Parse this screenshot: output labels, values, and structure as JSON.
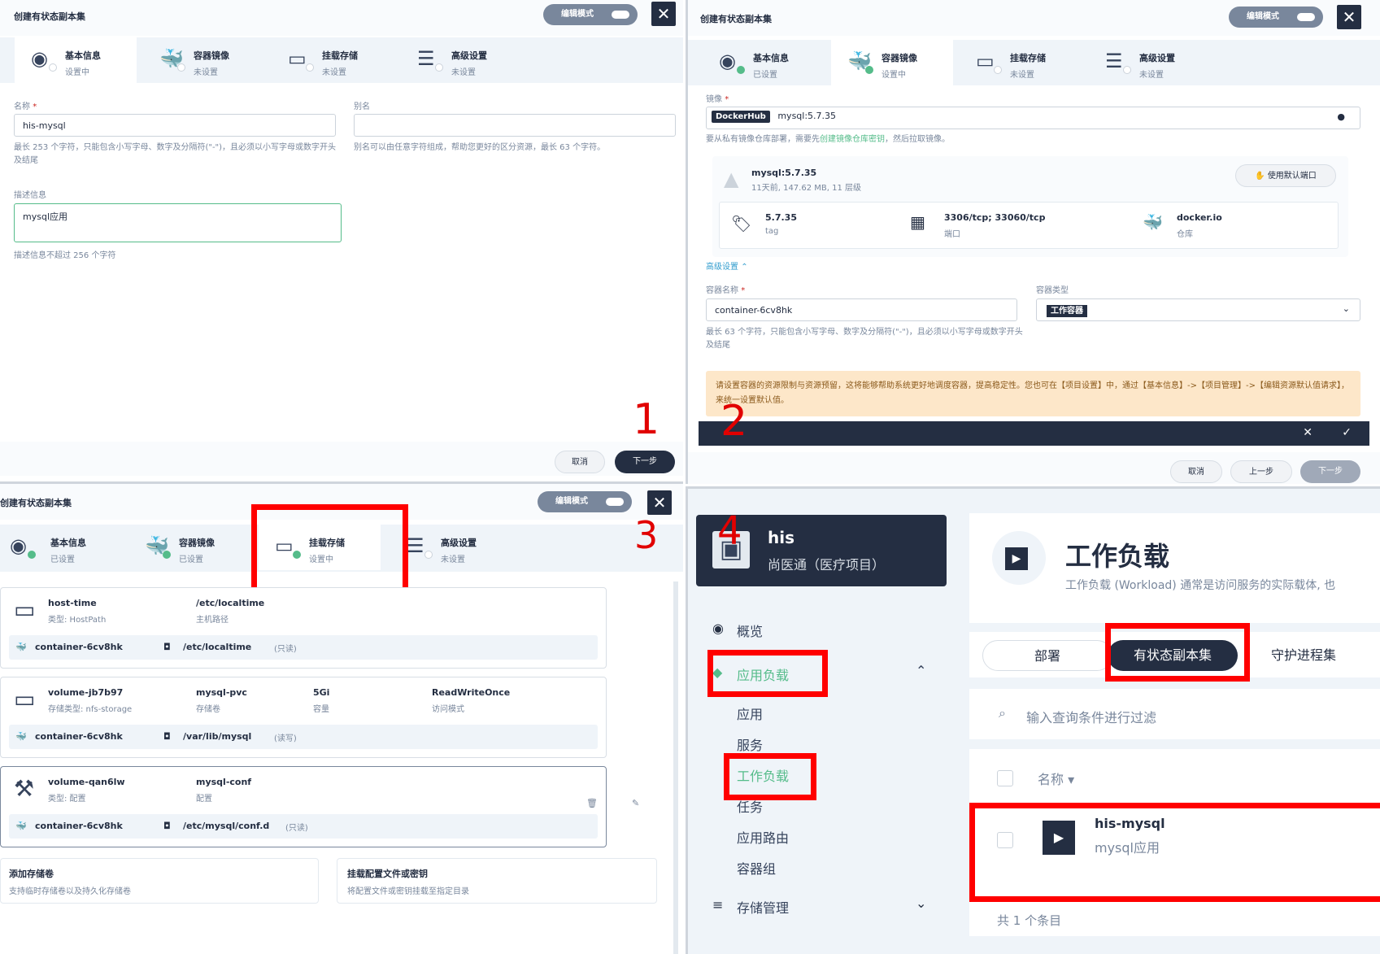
{
  "dialog": {
    "title": "创建有状态副本集",
    "edit_mode": "编辑模式",
    "close": "✕",
    "tabs": [
      {
        "label": "基本信息"
      },
      {
        "label": "容器镜像"
      },
      {
        "label": "挂载存储"
      },
      {
        "label": "高级设置"
      }
    ],
    "status_setting": "设置中",
    "status_unset": "未设置",
    "status_set": "已设置",
    "cancel": "取消",
    "prev": "上一步",
    "next": "下一步"
  },
  "panel1": {
    "name_label": "名称",
    "name_value": "his-mysql",
    "name_hint": "最长 253 个字符，只能包含小写字母、数字及分隔符(\"-\")，且必须以小写字母或数字开头及结尾",
    "alias_label": "别名",
    "alias_value": "",
    "alias_hint": "别名可以由任意字符组成，帮助您更好的区分资源，最长 63 个字符。",
    "desc_label": "描述信息",
    "desc_value": "mysql应用",
    "desc_hint": "描述信息不超过 256 个字符",
    "annotation": "1"
  },
  "panel2": {
    "image_label": "镜像",
    "registry_badge": "DockerHub",
    "image_value": "mysql:5.7.35",
    "image_hint_pre": "要从私有镜像仓库部署，需要先",
    "image_hint_link": "创建镜像仓库密钥",
    "image_hint_post": "，然后拉取镜像。",
    "image_name": "mysql:5.7.35",
    "image_meta": "11天前, 147.62 MB, 11 层级",
    "use_default_ports": "使用默认端口",
    "tag_value": "5.7.35",
    "tag_label": "tag",
    "ports_value": "3306/tcp; 33060/tcp",
    "ports_label": "端口",
    "repo_value": "docker.io",
    "repo_label": "仓库",
    "advanced": "高级设置",
    "container_name_label": "容器名称",
    "container_name_value": "container-6cv8hk",
    "container_type_label": "容器类型",
    "container_type_value": "工作容器",
    "container_name_hint": "最长 63 个字符，只能包含小写字母、数字及分隔符(\"-\")，且必须以小写字母或数字开头及结尾",
    "warning": "请设置容器的资源限制与资源预留，这将能够帮助系统更好地调度容器，提高稳定性。您也可在【项目设置】中，通过【基本信息】->【项目管理】->【编辑资源默认值请求】，来统一设置默认值。",
    "bar_cancel": "✕",
    "bar_ok": "✓",
    "annotation": "2"
  },
  "panel3": {
    "annotation": "3",
    "volumes": [
      {
        "name": "host-time",
        "type": "类型: HostPath",
        "c2": "/etc/localtime",
        "c2l": "主机路径",
        "c3": "",
        "c3l": "",
        "c4": "",
        "c4l": "",
        "container": "container-6cv8hk",
        "mount": "/etc/localtime",
        "mode": "(只读)"
      },
      {
        "name": "volume-jb7b97",
        "type": "存储类型: nfs-storage",
        "c2": "mysql-pvc",
        "c2l": "存储卷",
        "c3": "5Gi",
        "c3l": "容量",
        "c4": "ReadWriteOnce",
        "c4l": "访问模式",
        "container": "container-6cv8hk",
        "mount": "/var/lib/mysql",
        "mode": "(读写)"
      },
      {
        "name": "volume-qan6lw",
        "type": "类型: 配置",
        "c2": "mysql-conf",
        "c2l": "配置",
        "c3": "",
        "c3l": "",
        "c4": "",
        "c4l": "",
        "container": "container-6cv8hk",
        "mount": "/etc/mysql/conf.d",
        "mode": "(只读)"
      }
    ],
    "add_volume": "添加存储卷",
    "add_volume_desc": "支持临时存储卷以及持久化存储卷",
    "mount_config": "挂载配置文件或密钥",
    "mount_config_desc": "将配置文件或密钥挂载至指定目录"
  },
  "panel4": {
    "annotation": "4",
    "project_name": "his",
    "project_desc": "尚医通（医疗项目）",
    "nav": {
      "overview": "概览",
      "app_workloads": "应用负载",
      "apps": "应用",
      "services": "服务",
      "workloads": "工作负载",
      "jobs": "任务",
      "routes": "应用路由",
      "pods": "容器组",
      "storage": "存储管理"
    },
    "page_title": "工作负载",
    "page_desc": "工作负载 (Workload) 通常是访问服务的实际载体, 也",
    "tabs": [
      "部署",
      "有状态副本集",
      "守护进程集"
    ],
    "search_placeholder": "输入查询条件进行过滤",
    "col_name": "名称",
    "row_name": "his-mysql",
    "row_desc": "mysql应用",
    "total": "共 1 个条目"
  }
}
